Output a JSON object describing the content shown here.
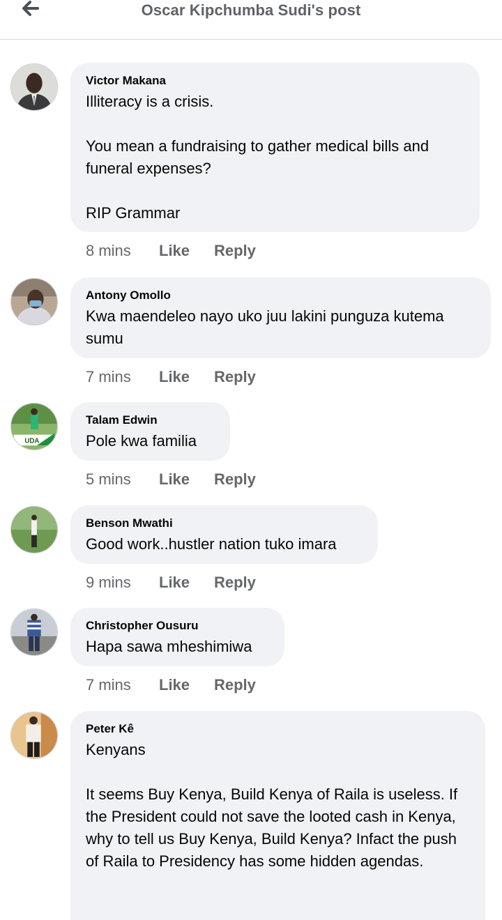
{
  "header": {
    "title": "Oscar Kipchumba Sudi's post"
  },
  "comments": [
    {
      "author": "Victor Makana",
      "text": "Illiteracy is a crisis.\n\nYou mean a fundraising to gather medical bills and funeral expenses?\n\nRIP Grammar",
      "time": "8 mins",
      "like": "Like",
      "reply": "Reply"
    },
    {
      "author": "Antony Omollo",
      "text": "Kwa maendeleo nayo uko juu lakini punguza kutema sumu",
      "time": "7 mins",
      "like": "Like",
      "reply": "Reply"
    },
    {
      "author": "Talam Edwin",
      "text": "Pole kwa familia",
      "time": "5 mins",
      "like": "Like",
      "reply": "Reply",
      "avatar_badge": "UDA"
    },
    {
      "author": "Benson Mwathi",
      "text": "Good work..hustler nation tuko imara",
      "time": "9 mins",
      "like": "Like",
      "reply": "Reply"
    },
    {
      "author": "Christopher Ousuru",
      "text": "Hapa sawa mheshimiwa",
      "time": "7 mins",
      "like": "Like",
      "reply": "Reply"
    },
    {
      "author": "Peter Kê",
      "text": "Kenyans\n\nIt seems Buy Kenya, Build Kenya of Raila is useless. If the President could not save the looted cash in Kenya, why to tell us Buy Kenya, Build Kenya? Infact the push of Raila to Presidency has some hidden agendas."
    }
  ],
  "icons": {
    "back": "arrow-left-icon"
  },
  "colors": {
    "bubble": "#f0f2f5",
    "meta": "#65676b",
    "title": "#5f6268"
  }
}
